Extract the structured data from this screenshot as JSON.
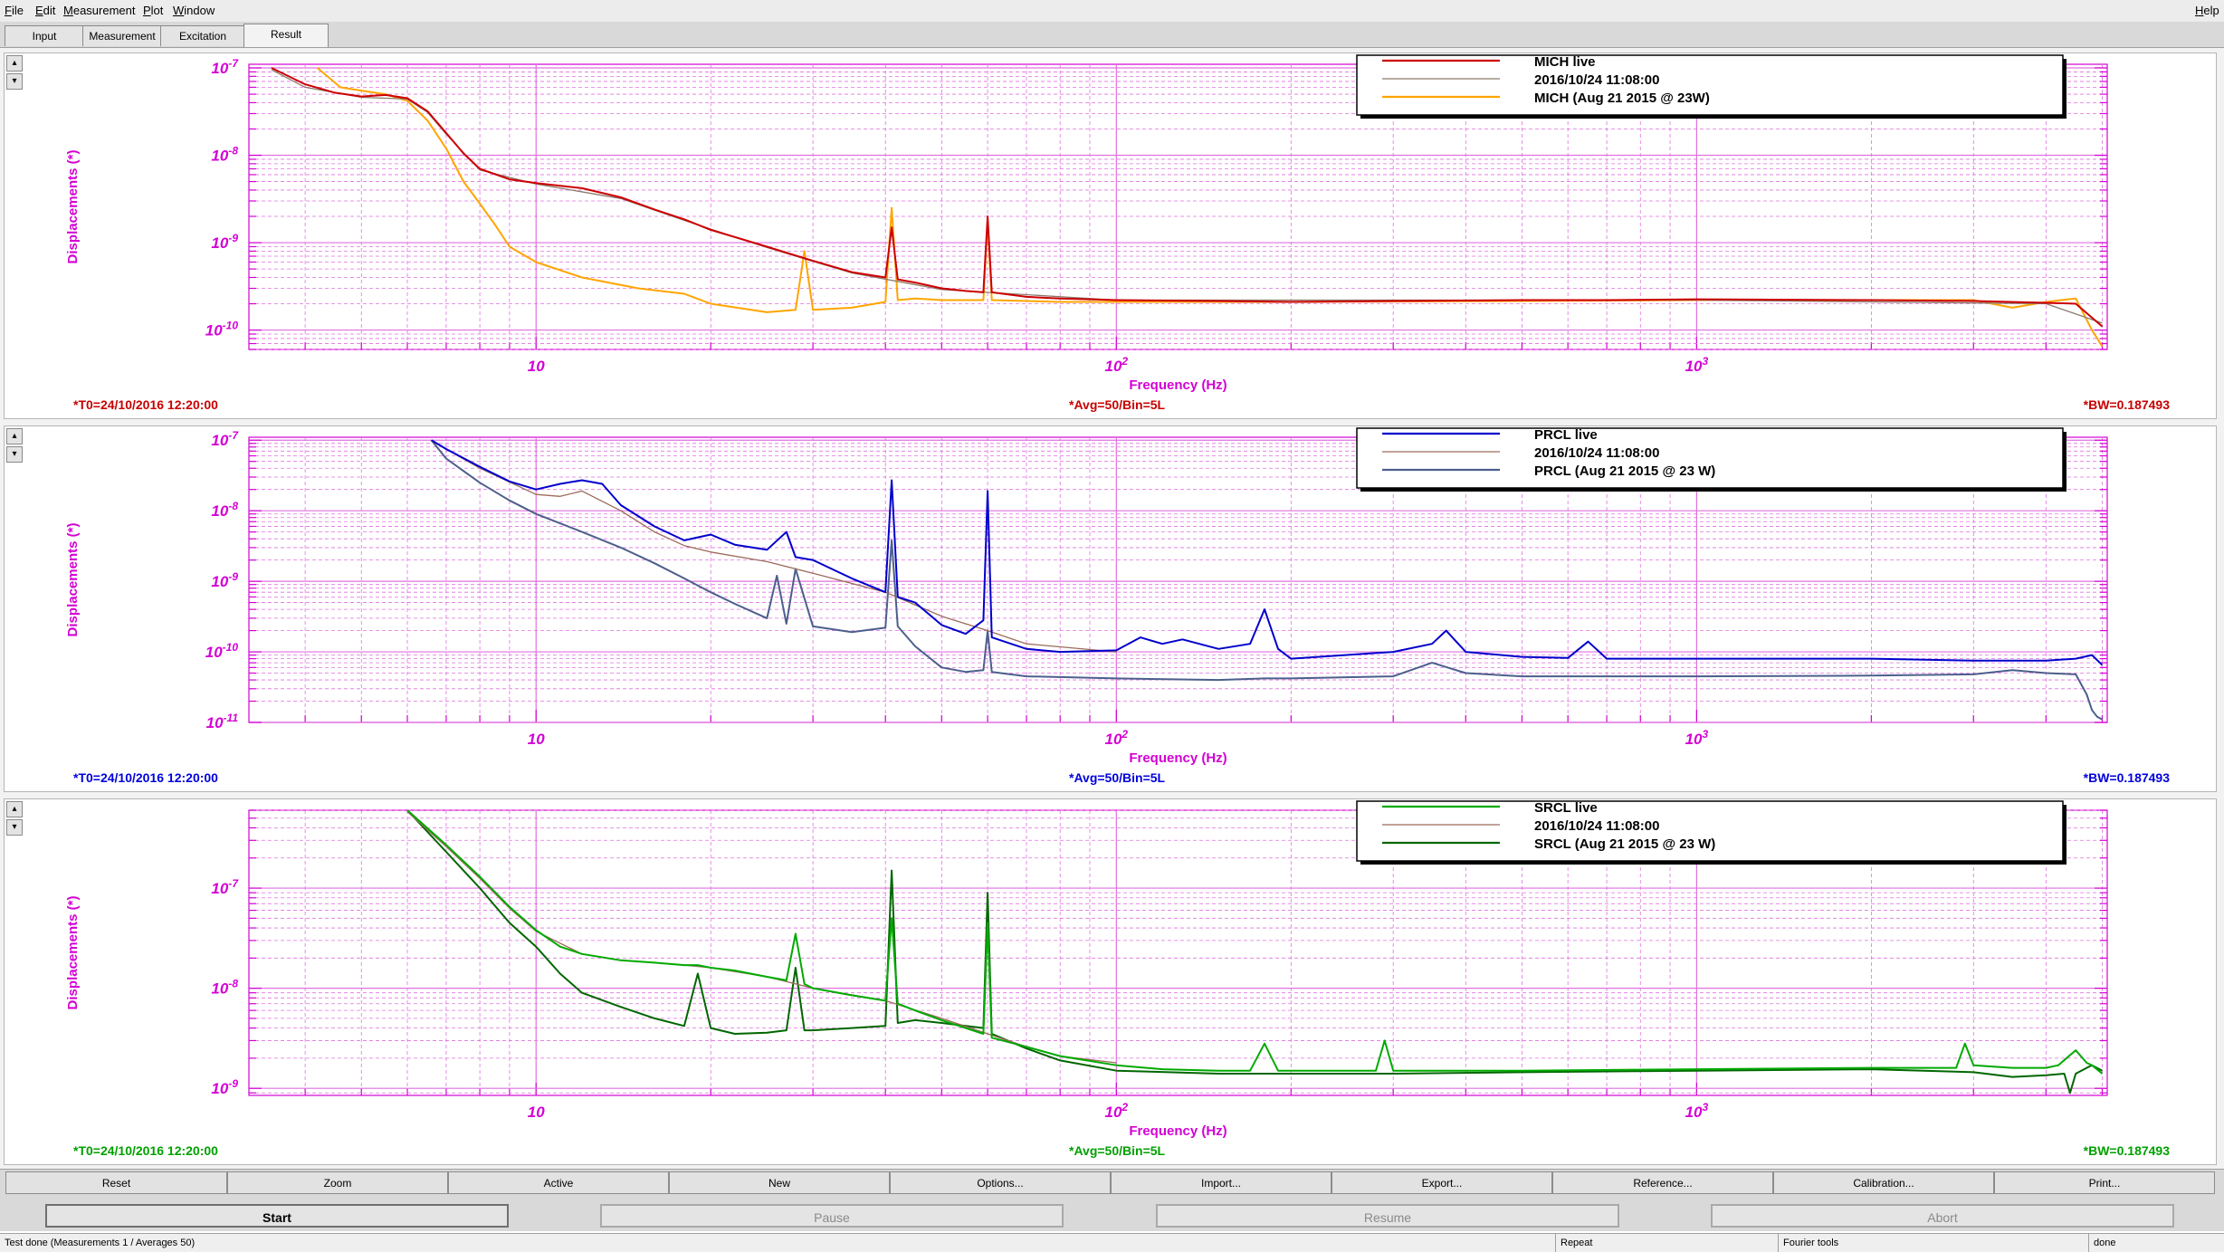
{
  "menubar": {
    "file": "File",
    "edit": "Edit",
    "measurement": "Measurement",
    "plot": "Plot",
    "window": "Window",
    "help": "Help"
  },
  "tabs": [
    "Input",
    "Measurement",
    "Excitation",
    "Result"
  ],
  "panel_arrows": {
    "up": "▴",
    "down": "▾"
  },
  "toolbar": [
    "Reset",
    "Zoom",
    "Active",
    "New",
    "Options...",
    "Import...",
    "Export...",
    "Reference...",
    "Calibration...",
    "Print..."
  ],
  "run_buttons": [
    "Start",
    "Pause",
    "Resume",
    "Abort"
  ],
  "status": {
    "left": "Test done (Measurements 1 / Averages 50)",
    "repeat": "Repeat",
    "tools": "Fourier tools",
    "state": "done"
  },
  "chart_data": [
    {
      "type": "line",
      "xscale": "log",
      "yscale": "log",
      "xlim": [
        3.2,
        5100
      ],
      "ylim": [
        6e-11,
        1.1e-07
      ],
      "xlabel": "Frequency (Hz)",
      "ylabel": "Displacements (*)",
      "grid": true,
      "legend_placement": "top-right",
      "x_ticks": [
        {
          "value": 10,
          "label": "10"
        },
        {
          "value": 100,
          "label": "10^2"
        },
        {
          "value": 1000,
          "label": "10^3"
        }
      ],
      "y_ticks": [
        {
          "value": 1e-07,
          "label": "10^-7"
        },
        {
          "value": 1e-08,
          "label": "10^-8"
        },
        {
          "value": 1e-09,
          "label": "10^-9"
        },
        {
          "value": 1e-10,
          "label": "10^-10"
        }
      ],
      "footer": {
        "left": "*T0=24/10/2016 12:20:00",
        "center": "*Avg=50/Bin=5L",
        "right": "*BW=0.187493"
      },
      "accent_color": "#c80000",
      "series": [
        {
          "name": "MICH live",
          "color": "#cc0000",
          "x": [
            3.5,
            4,
            4.5,
            5,
            5.5,
            6,
            6.5,
            7,
            7.5,
            8,
            9,
            10,
            12,
            14,
            16,
            18,
            20,
            25,
            30,
            35,
            40,
            41,
            42,
            45,
            50,
            55,
            59,
            60,
            61,
            70,
            80,
            90,
            100,
            150,
            200,
            300,
            500,
            700,
            1000,
            2000,
            3000,
            4000,
            4500,
            5000
          ],
          "y": [
            1e-07,
            6.5e-08,
            5.2e-08,
            4.7e-08,
            4.9e-08,
            4.5e-08,
            3.2e-08,
            1.8e-08,
            1.05e-08,
            7e-09,
            5.3e-09,
            4.8e-09,
            4.2e-09,
            3.3e-09,
            2.4e-09,
            1.85e-09,
            1.4e-09,
            9e-10,
            6.2e-10,
            4.6e-10,
            4e-10,
            1.5e-09,
            3.8e-10,
            3.5e-10,
            3e-10,
            2.8e-10,
            2.7e-10,
            2e-09,
            2.7e-10,
            2.4e-10,
            2.3e-10,
            2.25e-10,
            2.2e-10,
            2.15e-10,
            2.1e-10,
            2.15e-10,
            2.2e-10,
            2.2e-10,
            2.25e-10,
            2.2e-10,
            2.15e-10,
            2.05e-10,
            2e-10,
            1.1e-10
          ]
        },
        {
          "name": "2016/10/24 11:08:00",
          "color": "#8c7a6b",
          "x": [
            3.5,
            4,
            5,
            6,
            6.5,
            7,
            8,
            10,
            14,
            18,
            25,
            35,
            50,
            100,
            500,
            1000,
            4000,
            5000
          ],
          "y": [
            9.5e-08,
            6e-08,
            4.6e-08,
            4.4e-08,
            3.1e-08,
            1.75e-08,
            6.8e-09,
            4.7e-09,
            3.2e-09,
            1.8e-09,
            8.8e-10,
            4.5e-10,
            2.9e-10,
            2.2e-10,
            2.2e-10,
            2.2e-10,
            2e-10,
            1.2e-10
          ]
        },
        {
          "name": "MICH (Aug 21 2015 @ 23W)",
          "color": "#ffa500",
          "x": [
            4.2,
            4.6,
            5,
            5.5,
            6,
            6.5,
            7,
            7.5,
            8,
            8.5,
            9,
            10,
            12,
            15,
            18,
            20,
            25,
            28,
            29,
            30,
            35,
            40,
            41,
            42,
            45,
            50,
            55,
            59,
            60,
            61,
            70,
            80,
            100,
            200,
            500,
            1000,
            2000,
            3000,
            3500,
            4000,
            4500,
            4800,
            5000
          ],
          "y": [
            1e-07,
            6e-08,
            5.5e-08,
            5e-08,
            4.2e-08,
            2.5e-08,
            1.2e-08,
            5e-09,
            2.8e-09,
            1.6e-09,
            9e-10,
            6e-10,
            4e-10,
            3e-10,
            2.6e-10,
            2e-10,
            1.6e-10,
            1.7e-10,
            8e-10,
            1.7e-10,
            1.8e-10,
            2.1e-10,
            2.5e-09,
            2.2e-10,
            2.3e-10,
            2.2e-10,
            2.2e-10,
            2.2e-10,
            1.8e-09,
            2.2e-10,
            2.15e-10,
            2.1e-10,
            2.1e-10,
            2.1e-10,
            2.15e-10,
            2.2e-10,
            2.2e-10,
            2.2e-10,
            1.8e-10,
            2.1e-10,
            2.3e-10,
            1e-10,
            6.5e-11
          ]
        }
      ]
    },
    {
      "type": "line",
      "xscale": "log",
      "yscale": "log",
      "xlim": [
        3.2,
        5100
      ],
      "ylim": [
        1e-11,
        1.1e-07
      ],
      "xlabel": "Frequency (Hz)",
      "ylabel": "Displacements (*)",
      "grid": true,
      "legend_placement": "top-right",
      "x_ticks": [
        {
          "value": 10,
          "label": "10"
        },
        {
          "value": 100,
          "label": "10^2"
        },
        {
          "value": 1000,
          "label": "10^3"
        }
      ],
      "y_ticks": [
        {
          "value": 1e-07,
          "label": "10^-7"
        },
        {
          "value": 1e-08,
          "label": "10^-8"
        },
        {
          "value": 1e-09,
          "label": "10^-9"
        },
        {
          "value": 1e-10,
          "label": "10^-10"
        },
        {
          "value": 1e-11,
          "label": "10^-11"
        }
      ],
      "footer": {
        "left": "*T0=24/10/2016 12:20:00",
        "center": "*Avg=50/Bin=5L",
        "right": "*BW=0.187493"
      },
      "accent_color": "#0000dd",
      "series": [
        {
          "name": "PRCL live",
          "color": "#0000cc",
          "x": [
            6.6,
            7,
            8,
            9,
            10,
            11,
            12,
            13,
            14,
            16,
            18,
            20,
            22,
            25,
            27,
            28,
            30,
            35,
            40,
            41,
            42,
            45,
            50,
            55,
            59,
            60,
            61,
            70,
            80,
            100,
            110,
            120,
            130,
            150,
            170,
            180,
            190,
            200,
            300,
            350,
            370,
            400,
            500,
            600,
            650,
            700,
            1000,
            2000,
            3000,
            4000,
            4500,
            4800,
            5000
          ],
          "y": [
            1e-07,
            7.5e-08,
            4.2e-08,
            2.6e-08,
            2e-08,
            2.4e-08,
            2.7e-08,
            2.4e-08,
            1.2e-08,
            6e-09,
            3.8e-09,
            4.6e-09,
            3.3e-09,
            2.8e-09,
            5e-09,
            2.2e-09,
            2e-09,
            1.1e-09,
            7e-10,
            2.7e-08,
            6e-10,
            5e-10,
            2.4e-10,
            1.8e-10,
            2.8e-10,
            1.9e-08,
            1.6e-10,
            1.1e-10,
            1e-10,
            1.05e-10,
            1.6e-10,
            1.3e-10,
            1.5e-10,
            1.1e-10,
            1.3e-10,
            4e-10,
            1.1e-10,
            8e-11,
            1e-10,
            1.3e-10,
            2e-10,
            1e-10,
            8.5e-11,
            8.2e-11,
            1.4e-10,
            8e-11,
            8e-11,
            8e-11,
            7.5e-11,
            7.5e-11,
            8e-11,
            9e-11,
            6.5e-11
          ]
        },
        {
          "name": "2016/10/24 11:08:00",
          "color": "#9c6b5a",
          "x": [
            6.6,
            8,
            10,
            11,
            12,
            14,
            16,
            18,
            20,
            25,
            30,
            40,
            50,
            60,
            70,
            100
          ],
          "y": [
            9.8e-08,
            4e-08,
            1.7e-08,
            1.6e-08,
            1.9e-08,
            1e-08,
            5e-09,
            3.2e-09,
            2.6e-09,
            1.9e-09,
            1.3e-09,
            7e-10,
            3.2e-10,
            2e-10,
            1.3e-10,
            1e-10
          ]
        },
        {
          "name": "PRCL (Aug 21 2015 @ 23 W)",
          "color": "#4c5f8c",
          "x": [
            6.6,
            7,
            8,
            9,
            10,
            12,
            14,
            16,
            18,
            20,
            22,
            25,
            26,
            27,
            28,
            30,
            35,
            40,
            41,
            42,
            45,
            50,
            55,
            59,
            60,
            61,
            70,
            100,
            150,
            180,
            200,
            300,
            350,
            400,
            500,
            1000,
            2000,
            3000,
            3500,
            4000,
            4500,
            4700,
            4800,
            4900,
            5000
          ],
          "y": [
            1e-07,
            5.5e-08,
            2.5e-08,
            1.4e-08,
            9e-09,
            5e-09,
            3e-09,
            1.8e-09,
            1.1e-09,
            7e-10,
            4.8e-10,
            3e-10,
            1.2e-09,
            2.5e-10,
            1.5e-09,
            2.3e-10,
            1.9e-10,
            2.2e-10,
            3.8e-09,
            2.3e-10,
            1.2e-10,
            6e-11,
            5.2e-11,
            5.5e-11,
            2e-10,
            5.2e-11,
            4.5e-11,
            4.2e-11,
            4e-11,
            4.2e-11,
            4.2e-11,
            4.5e-11,
            7e-11,
            5e-11,
            4.5e-11,
            4.5e-11,
            4.6e-11,
            4.8e-11,
            5.5e-11,
            5e-11,
            4.8e-11,
            2.5e-11,
            1.5e-11,
            1.2e-11,
            1.1e-11
          ]
        }
      ]
    },
    {
      "type": "line",
      "xscale": "log",
      "yscale": "log",
      "xlim": [
        3.2,
        5100
      ],
      "ylim": [
        8.5e-10,
        6e-07
      ],
      "xlabel": "Frequency (Hz)",
      "ylabel": "Displacements (*)",
      "grid": true,
      "legend_placement": "top-right",
      "x_ticks": [
        {
          "value": 10,
          "label": "10"
        },
        {
          "value": 100,
          "label": "10^2"
        },
        {
          "value": 1000,
          "label": "10^3"
        }
      ],
      "y_ticks": [
        {
          "value": 1e-07,
          "label": "10^-7"
        },
        {
          "value": 1e-08,
          "label": "10^-8"
        },
        {
          "value": 1e-09,
          "label": "10^-9"
        }
      ],
      "footer": {
        "left": "*T0=24/10/2016 12:20:00",
        "center": "*Avg=50/Bin=5L",
        "right": "*BW=0.187493"
      },
      "accent_color": "#00a000",
      "series": [
        {
          "name": "SRCL live",
          "color": "#00aa00",
          "x": [
            6,
            7,
            8,
            9,
            10,
            11,
            12,
            14,
            16,
            18,
            19,
            20,
            22,
            25,
            27,
            28,
            29,
            30,
            35,
            40,
            41,
            42,
            45,
            50,
            59,
            60,
            61,
            70,
            80,
            100,
            120,
            150,
            170,
            180,
            190,
            200,
            280,
            290,
            300,
            500,
            1000,
            2000,
            2500,
            2800,
            2900,
            3000,
            3500,
            4000,
            4200,
            4500,
            4700,
            4800,
            5000
          ],
          "y": [
            6e-07,
            2.7e-07,
            1.3e-07,
            6.5e-08,
            3.8e-08,
            2.6e-08,
            2.2e-08,
            1.9e-08,
            1.8e-08,
            1.7e-08,
            1.7e-08,
            1.6e-08,
            1.5e-08,
            1.3e-08,
            1.2e-08,
            3.5e-08,
            1.1e-08,
            1e-08,
            8.5e-09,
            7.5e-09,
            5e-08,
            7e-09,
            6e-09,
            4.8e-09,
            3.5e-09,
            4.5e-08,
            3.2e-09,
            2.6e-09,
            2.1e-09,
            1.7e-09,
            1.55e-09,
            1.5e-09,
            1.5e-09,
            2.8e-09,
            1.5e-09,
            1.5e-09,
            1.5e-09,
            3e-09,
            1.5e-09,
            1.5e-09,
            1.55e-09,
            1.6e-09,
            1.6e-09,
            1.6e-09,
            2.8e-09,
            1.7e-09,
            1.6e-09,
            1.6e-09,
            1.7e-09,
            2.4e-09,
            1.8e-09,
            1.7e-09,
            1.4e-09
          ]
        },
        {
          "name": "2016/10/24 11:08:00",
          "color": "#9c6b5a",
          "x": [
            6,
            7,
            8,
            9,
            10,
            12,
            14,
            16,
            18,
            20,
            25,
            30,
            40,
            50,
            60,
            70,
            80,
            100
          ],
          "y": [
            5.8e-07,
            2.6e-07,
            1.25e-07,
            6.3e-08,
            3.7e-08,
            2.2e-08,
            1.9e-08,
            1.8e-08,
            1.7e-08,
            1.6e-08,
            1.3e-08,
            1e-08,
            7.5e-09,
            5e-09,
            3.5e-09,
            2.6e-09,
            2.1e-09,
            1.8e-09
          ]
        },
        {
          "name": "SRCL (Aug 21 2015 @ 23 W)",
          "color": "#006600",
          "x": [
            6,
            7,
            8,
            9,
            10,
            11,
            12,
            14,
            16,
            18,
            19,
            20,
            22,
            25,
            27,
            28,
            29,
            30,
            35,
            40,
            41,
            42,
            45,
            50,
            59,
            60,
            61,
            70,
            80,
            100,
            150,
            200,
            300,
            500,
            1000,
            2000,
            3000,
            3500,
            4000,
            4300,
            4400,
            4500,
            4700,
            4800,
            5000
          ],
          "y": [
            6e-07,
            2.3e-07,
            1e-07,
            4.5e-08,
            2.6e-08,
            1.4e-08,
            9e-09,
            6.5e-09,
            5e-09,
            4.2e-09,
            1.4e-08,
            4e-09,
            3.5e-09,
            3.6e-09,
            3.8e-09,
            1.6e-08,
            3.8e-09,
            3.8e-09,
            4e-09,
            4.2e-09,
            1.5e-07,
            4.5e-09,
            4.8e-09,
            4.5e-09,
            4e-09,
            9e-08,
            3.5e-09,
            2.5e-09,
            1.9e-09,
            1.5e-09,
            1.4e-09,
            1.4e-09,
            1.4e-09,
            1.45e-09,
            1.5e-09,
            1.55e-09,
            1.45e-09,
            1.3e-09,
            1.35e-09,
            1.4e-09,
            9e-10,
            1.4e-09,
            1.6e-09,
            1.7e-09,
            1.5e-09
          ]
        }
      ]
    }
  ]
}
